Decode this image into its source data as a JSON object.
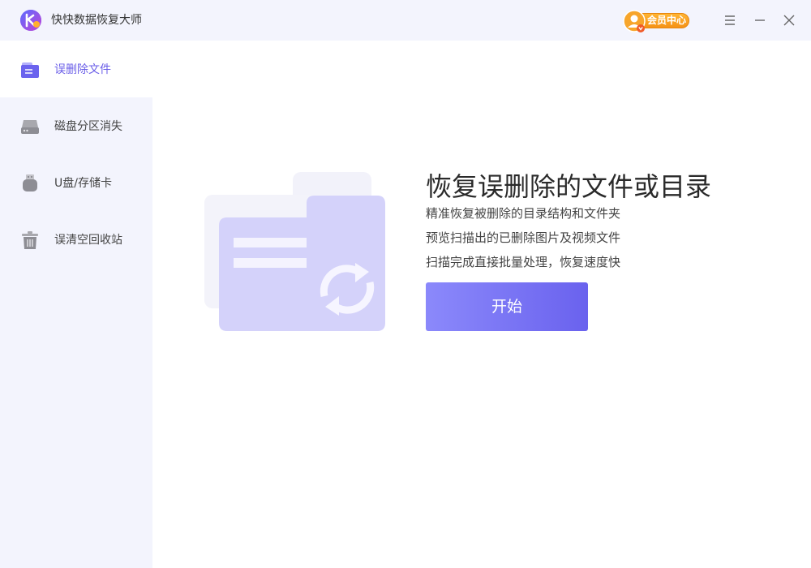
{
  "app": {
    "title": "快快数据恢复大师"
  },
  "header": {
    "vip_label": "会员中心",
    "controls": [
      "menu-icon",
      "minimize-icon",
      "close-icon"
    ]
  },
  "sidebar": {
    "items": [
      {
        "label": "误删除文件",
        "icon": "document-folder-icon",
        "active": true
      },
      {
        "label": "磁盘分区消失",
        "icon": "hard-disk-icon",
        "active": false
      },
      {
        "label": "U盘/存储卡",
        "icon": "usb-drive-icon",
        "active": false
      },
      {
        "label": "误清空回收站",
        "icon": "trash-icon",
        "active": false
      }
    ]
  },
  "main": {
    "headline": "恢复误删除的文件或目录",
    "features": [
      "精准恢复被删除的目录结构和文件夹",
      "预览扫描出的已删除图片及视频文件",
      "扫描完成直接批量处理，恢复速度快"
    ],
    "start_button": "开始",
    "illustration": "folder-recover-icon"
  },
  "colors": {
    "accent": "#6a5ee8",
    "sidebar_bg": "#f3f4fd",
    "button_start": "#8b89fb",
    "button_end": "#6a62ee",
    "vip_orange": "#f59216"
  }
}
